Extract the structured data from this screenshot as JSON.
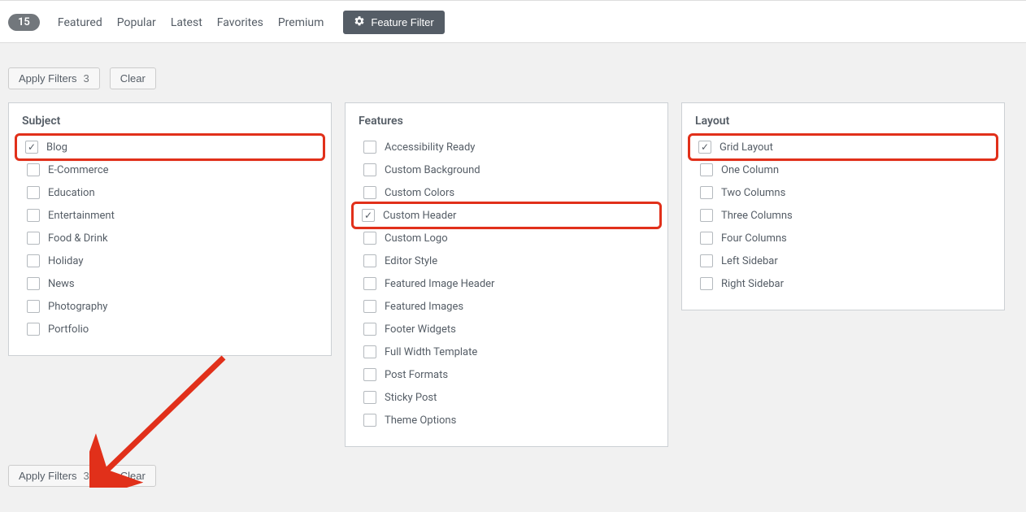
{
  "topbar": {
    "count": "15",
    "tabs": [
      "Featured",
      "Popular",
      "Latest",
      "Favorites",
      "Premium"
    ],
    "feature_filter": "Feature Filter"
  },
  "buttons": {
    "apply_filters": "Apply Filters",
    "apply_count": "3",
    "clear": "Clear"
  },
  "panels": {
    "subject": {
      "title": "Subject",
      "items": [
        {
          "label": "Blog",
          "checked": true,
          "highlight": true
        },
        {
          "label": "E-Commerce",
          "checked": false
        },
        {
          "label": "Education",
          "checked": false
        },
        {
          "label": "Entertainment",
          "checked": false
        },
        {
          "label": "Food & Drink",
          "checked": false
        },
        {
          "label": "Holiday",
          "checked": false
        },
        {
          "label": "News",
          "checked": false
        },
        {
          "label": "Photography",
          "checked": false
        },
        {
          "label": "Portfolio",
          "checked": false
        }
      ]
    },
    "features": {
      "title": "Features",
      "items": [
        {
          "label": "Accessibility Ready",
          "checked": false
        },
        {
          "label": "Custom Background",
          "checked": false
        },
        {
          "label": "Custom Colors",
          "checked": false
        },
        {
          "label": "Custom Header",
          "checked": true,
          "highlight": true
        },
        {
          "label": "Custom Logo",
          "checked": false
        },
        {
          "label": "Editor Style",
          "checked": false
        },
        {
          "label": "Featured Image Header",
          "checked": false
        },
        {
          "label": "Featured Images",
          "checked": false
        },
        {
          "label": "Footer Widgets",
          "checked": false
        },
        {
          "label": "Full Width Template",
          "checked": false
        },
        {
          "label": "Post Formats",
          "checked": false
        },
        {
          "label": "Sticky Post",
          "checked": false
        },
        {
          "label": "Theme Options",
          "checked": false
        }
      ]
    },
    "layout": {
      "title": "Layout",
      "items": [
        {
          "label": "Grid Layout",
          "checked": true,
          "highlight": true
        },
        {
          "label": "One Column",
          "checked": false
        },
        {
          "label": "Two Columns",
          "checked": false
        },
        {
          "label": "Three Columns",
          "checked": false
        },
        {
          "label": "Four Columns",
          "checked": false
        },
        {
          "label": "Left Sidebar",
          "checked": false
        },
        {
          "label": "Right Sidebar",
          "checked": false
        }
      ]
    }
  }
}
